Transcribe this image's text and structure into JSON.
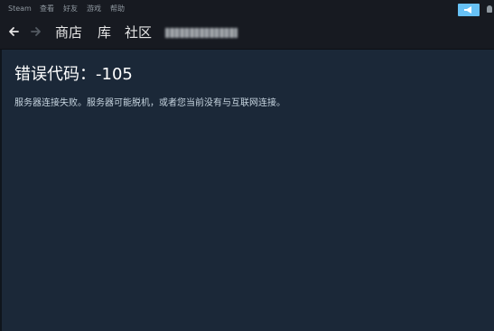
{
  "menubar": {
    "items": [
      "Steam",
      "查看",
      "好友",
      "游戏",
      "帮助"
    ]
  },
  "nav": {
    "tabs": [
      "商店",
      "库",
      "社区"
    ]
  },
  "error": {
    "title": "错误代码：-105",
    "message": "服务器连接失败。服务器可能脱机，或者您当前没有与互联网连接。"
  },
  "colors": {
    "background": "#1b2838",
    "menubar": "#171a21",
    "notification_button": "#67c1f5",
    "title_text": "#ffffff",
    "body_text": "#c6d4df"
  },
  "icons": {
    "back": "arrow-left-icon",
    "forward": "arrow-right-icon",
    "notification": "megaphone-icon"
  }
}
